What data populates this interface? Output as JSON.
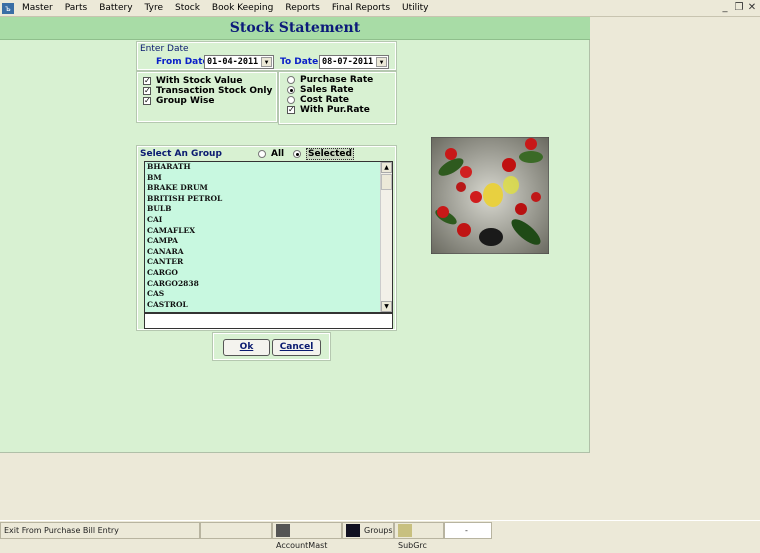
{
  "menubar": {
    "items": [
      "Master",
      "Parts",
      "Battery",
      "Tyre",
      "Stock",
      "Book Keeping",
      "Reports",
      "Final Reports",
      "Utility"
    ],
    "controls": {
      "minimize": "_",
      "restore": "❐",
      "close": "✕"
    }
  },
  "form": {
    "title": "Stock Statement",
    "date": {
      "heading": "Enter Date",
      "from_label": "From Date",
      "from_value": "01-04-2011",
      "to_label": "To Date",
      "to_value": "08-07-2011"
    },
    "options": [
      {
        "label": "With Stock Value",
        "checked": true
      },
      {
        "label": "Transaction Stock Only",
        "checked": true
      },
      {
        "label": "Group Wise",
        "checked": true
      }
    ],
    "rates": [
      {
        "label": "Purchase Rate",
        "selected": false
      },
      {
        "label": "Sales Rate",
        "selected": true
      },
      {
        "label": "Cost Rate",
        "selected": false
      }
    ],
    "with_pur_rate": {
      "label": "With Pur.Rate",
      "checked": true
    },
    "group": {
      "heading": "Select An Group",
      "all_label": "All",
      "selected_label": "Selected",
      "mode": "Selected",
      "items": [
        "BHARATH",
        "BM",
        "BRAKE DRUM",
        "BRITISH PETROL",
        "BULB",
        "CAI",
        "CAMAFLEX",
        "CAMPA",
        "CANARA",
        "CANTER",
        "CARGO",
        "CARGO2838",
        "CAS",
        "CASTROL"
      ],
      "search_value": ""
    },
    "ok_label": "Ok",
    "cancel_label": "Cancel"
  },
  "statusbar": {
    "message": "Exit From Purchase Bill Entry",
    "panels": [
      "AccountMast",
      "Groups",
      "SubGrc",
      "-"
    ]
  },
  "colors": {
    "form_bg": "#d8f1d2",
    "title_bg": "#a8dca6",
    "title_text": "#0c1a7a",
    "list_bg": "#c8f8e0",
    "label_blue": "#0a20c8"
  }
}
